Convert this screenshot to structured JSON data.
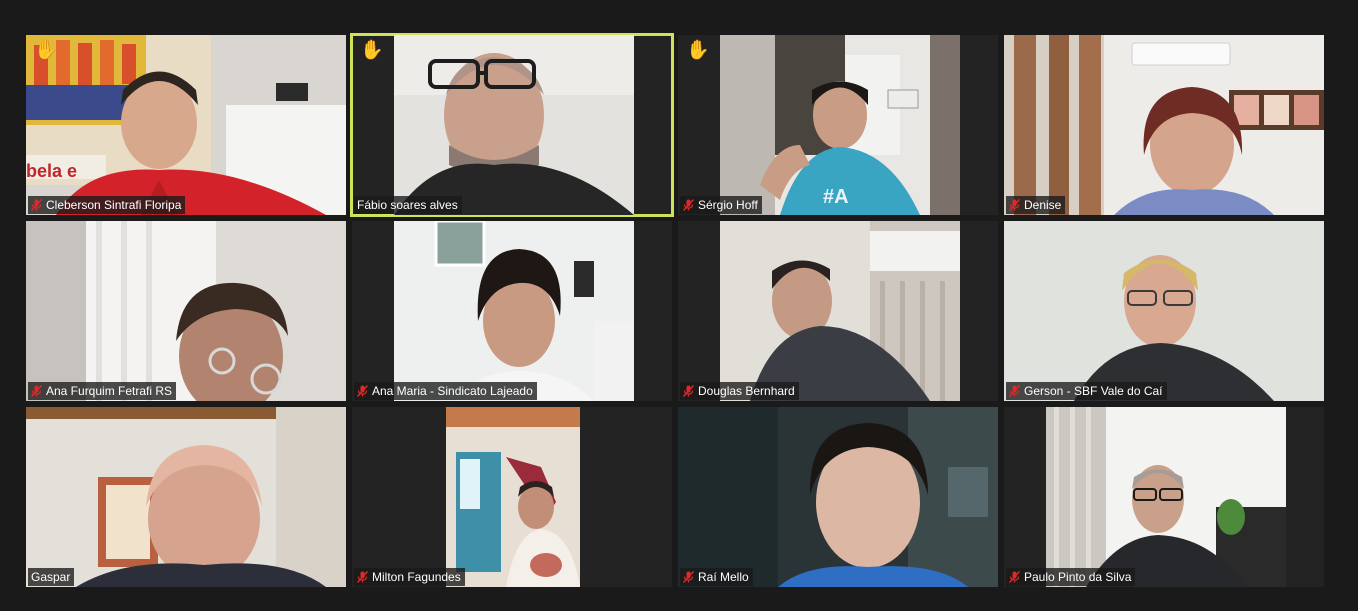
{
  "app": {
    "view": "gallery"
  },
  "colors": {
    "background": "#1a1a1a",
    "tile_background": "#232323",
    "active_speaker_border": "#cde35a",
    "muted_icon": "#e02828",
    "raised_hand": "#f6c02c"
  },
  "participants": [
    {
      "name": "Cleberson Sintrafi Floripa",
      "muted": true,
      "hand_raised": true,
      "active_speaker": false
    },
    {
      "name": "Fábio soares alves",
      "muted": false,
      "hand_raised": true,
      "active_speaker": true
    },
    {
      "name": "Sérgio Hoff",
      "muted": true,
      "hand_raised": true,
      "active_speaker": false
    },
    {
      "name": "Denise",
      "muted": true,
      "hand_raised": false,
      "active_speaker": false
    },
    {
      "name": "Ana Furquim Fetrafi RS",
      "muted": true,
      "hand_raised": false,
      "active_speaker": false
    },
    {
      "name": "Ana Maria - Sindicato Lajeado",
      "muted": true,
      "hand_raised": false,
      "active_speaker": false
    },
    {
      "name": "Douglas Bernhard",
      "muted": true,
      "hand_raised": false,
      "active_speaker": false
    },
    {
      "name": "Gerson - SBF Vale do Caí",
      "muted": true,
      "hand_raised": false,
      "active_speaker": false
    },
    {
      "name": "Gaspar",
      "muted": false,
      "hand_raised": false,
      "active_speaker": false
    },
    {
      "name": "Milton Fagundes",
      "muted": true,
      "hand_raised": false,
      "active_speaker": false
    },
    {
      "name": "Raí Mello",
      "muted": true,
      "hand_raised": false,
      "active_speaker": false
    },
    {
      "name": "Paulo Pinto da Silva",
      "muted": true,
      "hand_raised": false,
      "active_speaker": false
    }
  ],
  "icons": {
    "raised_hand": "✋",
    "muted_mic": "muted-mic-icon"
  }
}
